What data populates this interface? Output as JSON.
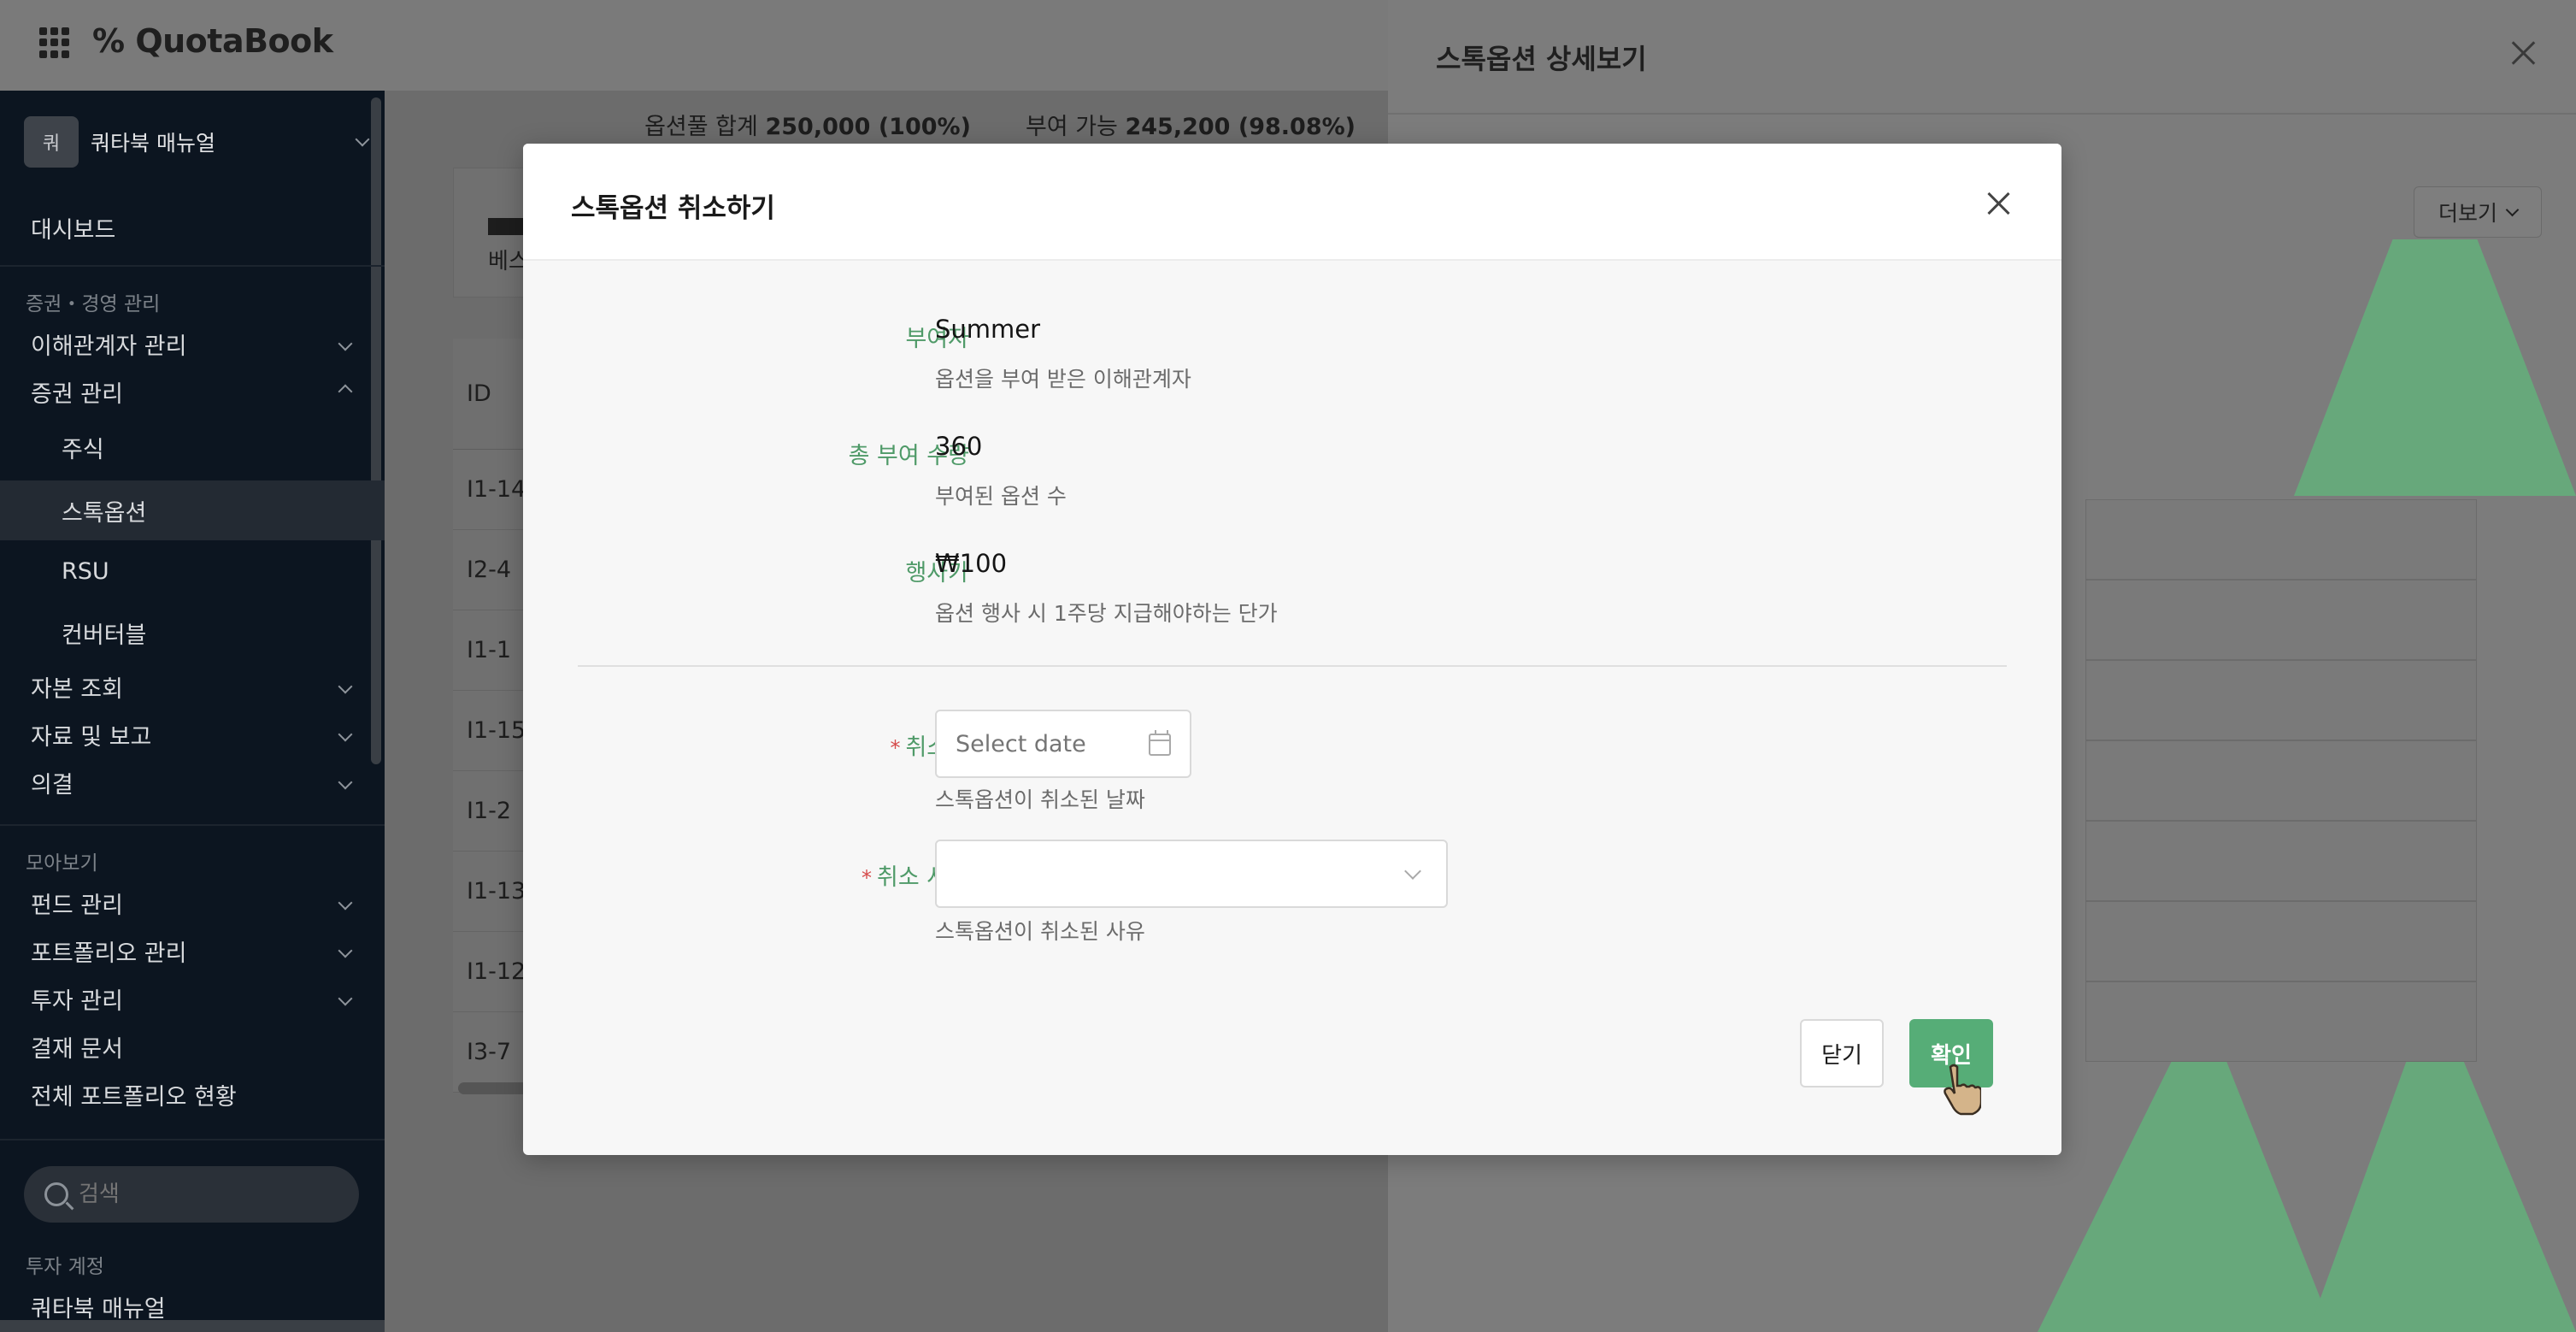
{
  "header": {
    "logo": "QuotaBook"
  },
  "sidebar": {
    "workspace_avatar": "쿼",
    "workspace_name": "쿼타북 매뉴얼",
    "dashboard": "대시보드",
    "section_securities": "증권・경영 관리",
    "items": [
      {
        "label": "이해관계자 관리"
      },
      {
        "label": "증권 관리"
      },
      {
        "label": "주식"
      },
      {
        "label": "스톡옵션"
      },
      {
        "label": "RSU"
      },
      {
        "label": "컨버터블"
      },
      {
        "label": "자본 조회"
      },
      {
        "label": "자료 및 보고"
      },
      {
        "label": "의결"
      }
    ],
    "section_overview": "모아보기",
    "items2": [
      {
        "label": "펀드 관리"
      },
      {
        "label": "포트폴리오 관리"
      },
      {
        "label": "투자 관리"
      },
      {
        "label": "결재 문서"
      },
      {
        "label": "전체 포트폴리오 현황"
      }
    ],
    "search_placeholder": "검색",
    "section_accounts": "투자 계정",
    "account_item": "쿼타북 매뉴얼"
  },
  "main": {
    "summary_pool_label": "옵션풀 합계",
    "summary_pool_value": "250,000 (100%)",
    "summary_avail_label": "부여 가능",
    "summary_avail_value": "245,200 (98.08%)",
    "card_label": "베스",
    "table_header": "ID",
    "rows": [
      "I1-14",
      "I2-4",
      "I1-1",
      "I1-15",
      "I1-2",
      "I1-13",
      "I1-12",
      "I3-7"
    ]
  },
  "drawer": {
    "title": "스톡옵션 상세보기",
    "more_label": "더보기"
  },
  "modal": {
    "title": "스톡옵션 취소하기",
    "fields": {
      "grantee_label": "부여자",
      "grantee_value": "Summer",
      "grantee_help": "옵션을 부여 받은 이해관계자",
      "total_label": "총 부여 수량",
      "total_value": "360",
      "total_help": "부여된 옵션 수",
      "strike_label": "행사가",
      "strike_value": "₩100",
      "strike_help": "옵션 행사 시 1주당 지급해야하는 단가",
      "cancel_date_label": "취소일",
      "cancel_date_placeholder": "Select date",
      "cancel_date_help": "스톡옵션이 취소된 날짜",
      "cancel_reason_label": "취소 사유",
      "cancel_reason_value": "",
      "cancel_reason_help": "스톡옵션이 취소된 사유"
    },
    "required_mark": "*",
    "close_button": "닫기",
    "confirm_button": "확인"
  },
  "colors": {
    "accent": "#56ad77",
    "label_green": "#4f9a68",
    "required": "#d54a4a",
    "sidebar_bg": "#0c1520"
  }
}
